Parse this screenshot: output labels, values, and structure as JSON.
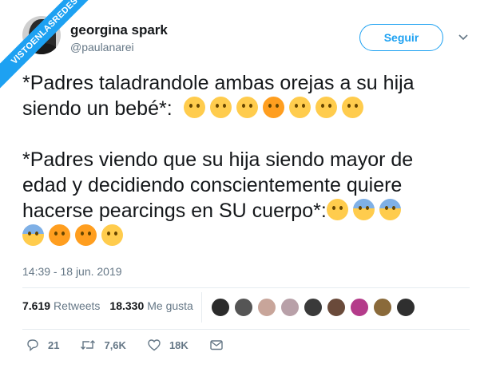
{
  "watermark": {
    "text": "VISTOENLASREDES"
  },
  "tweet": {
    "author_name": "georgina spark",
    "author_handle": "@paulanarei",
    "follow_label": "Seguir",
    "line1": "*Padres taladrandole ambas orejas a su hija",
    "line2": "siendo un bebé*:",
    "line3": "*Padres viendo que su hija siendo mayor de",
    "line4": "edad y decidiendo conscientemente quiere",
    "line5": "hacerse pearcings en SU cuerpo*:",
    "emojis_first": [
      "smiling-blush-emoji",
      "grin-emoji",
      "grin-emoji",
      "heart-eyes-emoji",
      "kissing-closed-eyes-emoji",
      "kissing-closed-eyes-emoji",
      "kissing-closed-eyes-emoji"
    ],
    "emojis_second": [
      "anxious-emoji",
      "sad-sweat-emoji",
      "screaming-fear-emoji",
      "screaming-fear-emoji",
      "angry-emoji",
      "angry-emoji",
      "steam-nose-emoji"
    ],
    "timestamp": "14:39 - 18 jun. 2019"
  },
  "stats": {
    "retweets_count": "7.619",
    "retweets_label": "Retweets",
    "likes_count": "18.330",
    "likes_label": "Me gusta",
    "liker_avatar_colors": [
      "#2b2b2b",
      "#555555",
      "#c8a59a",
      "#b8a0a8",
      "#3a3a3a",
      "#6a4a3a",
      "#b43b8a",
      "#8a6a3a",
      "#2f2f2f"
    ]
  },
  "actions": {
    "replies": "21",
    "retweets": "7,6K",
    "likes": "18K"
  },
  "colors": {
    "accent": "#1da1f2",
    "muted": "#657786",
    "text": "#14171a"
  }
}
